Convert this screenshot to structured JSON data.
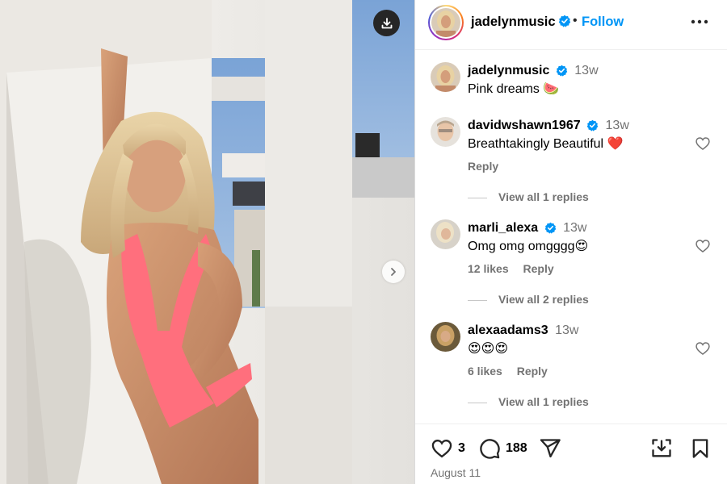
{
  "media": {
    "download_icon": "download-icon",
    "next_icon": "chevron-right-icon"
  },
  "header": {
    "username": "jadelynmusic",
    "separator": "•",
    "follow_label": "Follow",
    "more_icon": "more-horizontal-icon"
  },
  "caption": {
    "username": "jadelynmusic",
    "time": "13w",
    "text": "Pink dreams 🍉"
  },
  "comments": [
    {
      "username": "davidwshawn1967",
      "verified": true,
      "time": "13w",
      "text": "Breathtakingly Beautiful ❤️",
      "likes": "",
      "reply_label": "Reply",
      "view_replies": "View all 1 replies"
    },
    {
      "username": "marli_alexa",
      "verified": true,
      "time": "13w",
      "text": "Omg omg omgggg😍",
      "likes": "12 likes",
      "reply_label": "Reply",
      "view_replies": "View all 2 replies"
    },
    {
      "username": "alexaadams3",
      "verified": false,
      "time": "13w",
      "text": "😍😍😍",
      "likes": "6 likes",
      "reply_label": "Reply",
      "view_replies": "View all 1 replies"
    }
  ],
  "actions": {
    "like_count": "3",
    "comment_count": "188",
    "date": "August 11"
  },
  "colors": {
    "accent": "#0095f6",
    "verified": "#0095f6",
    "muted": "#737373",
    "swimsuit": "#ff6f7d"
  }
}
